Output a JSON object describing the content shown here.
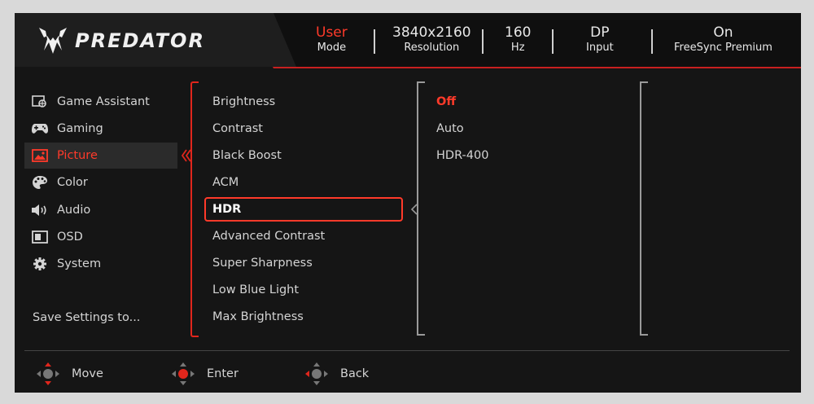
{
  "header": {
    "logo_text": "PREDATOR",
    "status": [
      {
        "value": "User",
        "label": "Mode",
        "highlight": true
      },
      {
        "value": "3840x2160",
        "label": "Resolution",
        "highlight": false
      },
      {
        "value": "160",
        "label": "Hz",
        "highlight": false
      },
      {
        "value": "DP",
        "label": "Input",
        "highlight": false
      },
      {
        "value": "On",
        "label": "FreeSync Premium",
        "highlight": false
      }
    ]
  },
  "menu": {
    "items": [
      {
        "label": "Game Assistant",
        "icon": "game-assistant-icon"
      },
      {
        "label": "Gaming",
        "icon": "gamepad-icon"
      },
      {
        "label": "Picture",
        "icon": "picture-icon",
        "active": true
      },
      {
        "label": "Color",
        "icon": "palette-icon"
      },
      {
        "label": "Audio",
        "icon": "speaker-icon"
      },
      {
        "label": "OSD",
        "icon": "osd-icon"
      },
      {
        "label": "System",
        "icon": "gear-icon"
      }
    ],
    "save_settings": "Save Settings to..."
  },
  "picture_menu": {
    "items": [
      "Brightness",
      "Contrast",
      "Black Boost",
      "ACM",
      "HDR",
      "Advanced Contrast",
      "Super Sharpness",
      "Low Blue Light",
      "Max Brightness"
    ],
    "selected": "HDR"
  },
  "hdr_options": {
    "items": [
      "Off",
      "Auto",
      "HDR-400"
    ],
    "selected": "Off"
  },
  "footer": {
    "move": "Move",
    "enter": "Enter",
    "back": "Back"
  },
  "colors": {
    "accent": "#ff3a2a",
    "background": "#151515",
    "text": "#d4d4d4"
  }
}
